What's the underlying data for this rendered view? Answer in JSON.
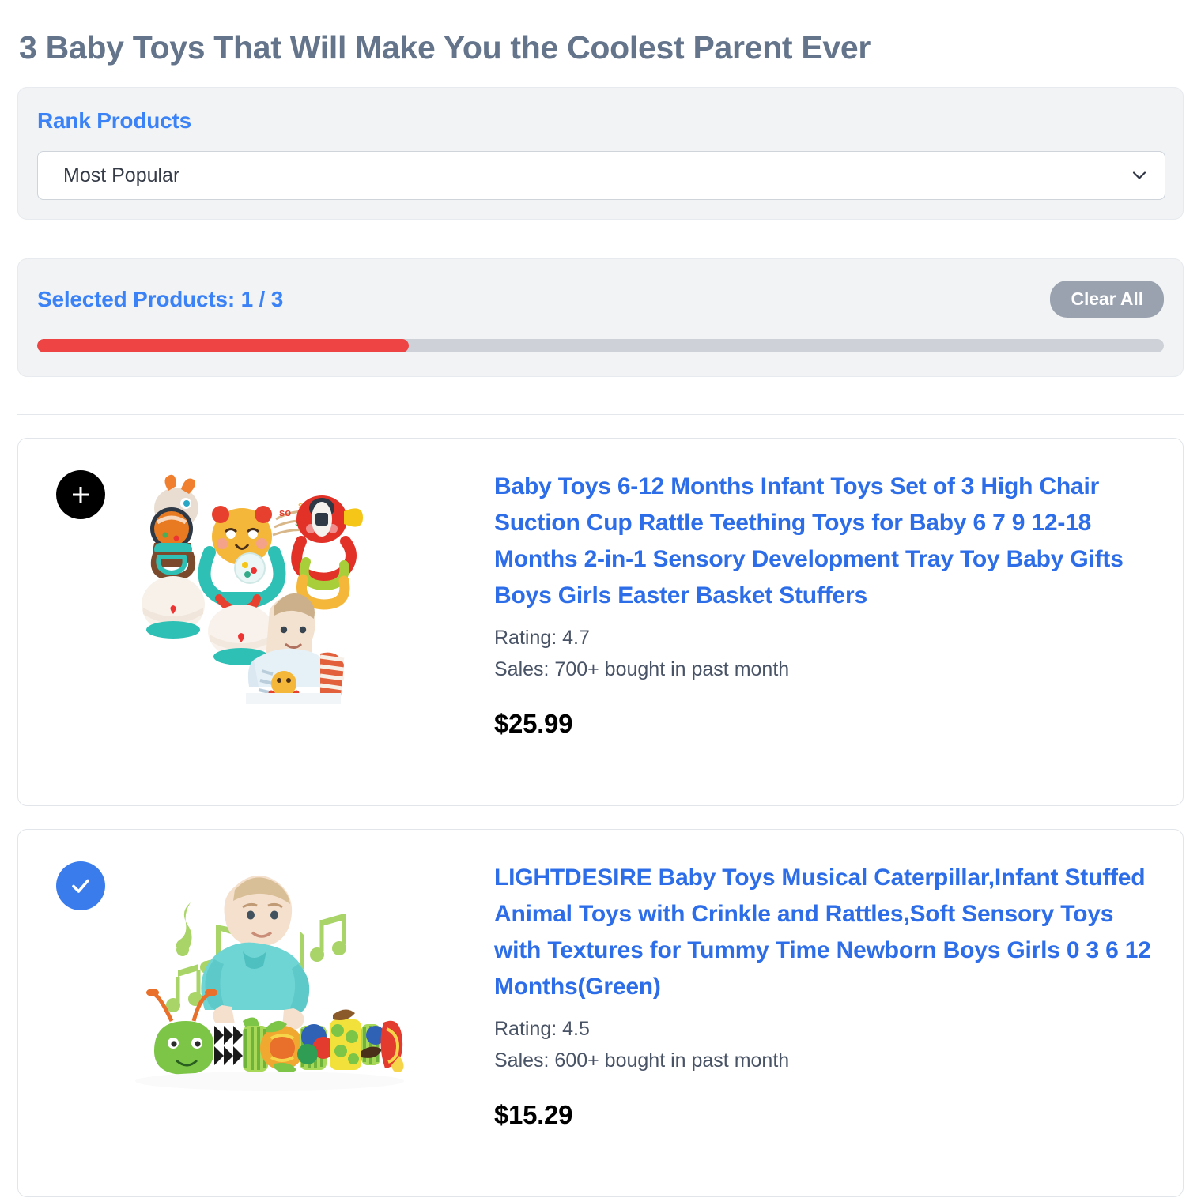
{
  "page": {
    "title": "3 Baby Toys That Will Make You the Coolest Parent Ever"
  },
  "rank_panel": {
    "label": "Rank Products",
    "select": {
      "selected": "Most Popular",
      "icon": "chevron-down-icon"
    }
  },
  "selected_panel": {
    "count_label": "Selected Products: 1 / 3",
    "clear_label": "Clear All",
    "progress_percent": 33,
    "progress_fill_color": "#ef4444",
    "progress_track_color": "#ced2d8"
  },
  "colors": {
    "accent_blue": "#3b82f6",
    "link_blue": "#2d6ee8",
    "title_gray": "#64748b",
    "panel_bg": "#f1f3f5",
    "clear_button": "#9aa2b0",
    "selected_toggle": "#3b7ced",
    "unselected_toggle": "#000000"
  },
  "products": [
    {
      "selected": false,
      "toggle_icon": "plus-icon",
      "image_alt": "baby-rattle-toy-set-image",
      "title": "Baby Toys 6-12 Months Infant Toys Set of 3 High Chair Suction Cup Rattle Teething Toys for Baby 6 7 9 12-18 Months 2-in-1 Sensory Development Tray Toy Baby Gifts Boys Girls Easter Basket Stuffers",
      "rating": "Rating: 4.7",
      "sales": "Sales: 700+ bought in past month",
      "price": "$25.99"
    },
    {
      "selected": true,
      "toggle_icon": "check-icon",
      "image_alt": "musical-caterpillar-toy-image",
      "title": "LIGHTDESIRE Baby Toys Musical Caterpillar,Infant Stuffed Animal Toys with Crinkle and Rattles,Soft Sensory Toys with Textures for Tummy Time Newborn Boys Girls 0 3 6 12 Months(Green)",
      "rating": "Rating: 4.5",
      "sales": "Sales: 600+ bought in past month",
      "price": "$15.29"
    }
  ]
}
